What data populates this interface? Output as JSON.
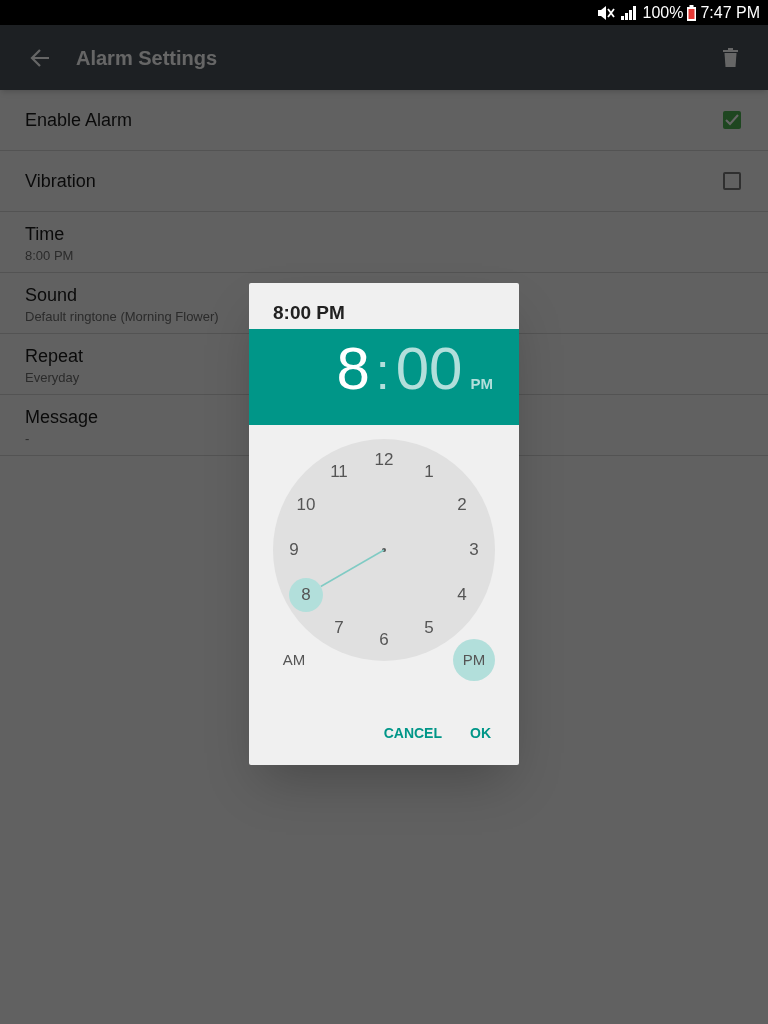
{
  "status_bar": {
    "battery": "100%",
    "time": "7:47 PM"
  },
  "toolbar": {
    "title": "Alarm Settings"
  },
  "settings": [
    {
      "kind": "checkbox",
      "title": "Enable Alarm",
      "checked": true
    },
    {
      "kind": "checkbox",
      "title": "Vibration",
      "checked": false
    },
    {
      "kind": "value",
      "title": "Time",
      "value": "8:00 PM"
    },
    {
      "kind": "value",
      "title": "Sound",
      "value": "Default ringtone (Morning Flower)"
    },
    {
      "kind": "value",
      "title": "Repeat",
      "value": "Everyday"
    },
    {
      "kind": "value",
      "title": "Message",
      "value": "-"
    }
  ],
  "dialog": {
    "title": "8:00 PM",
    "time_header": {
      "hour": {
        "text": "8",
        "selected": true
      },
      "separator": ":",
      "minute": {
        "text": "00",
        "selected": false
      },
      "period": "PM"
    },
    "dial": [
      {
        "label": "12",
        "selected": false
      },
      {
        "label": "1",
        "selected": false
      },
      {
        "label": "2",
        "selected": false
      },
      {
        "label": "3",
        "selected": false
      },
      {
        "label": "4",
        "selected": false
      },
      {
        "label": "5",
        "selected": false
      },
      {
        "label": "6",
        "selected": false
      },
      {
        "label": "7",
        "selected": false
      },
      {
        "label": "8",
        "selected": true
      },
      {
        "label": "9",
        "selected": false
      },
      {
        "label": "10",
        "selected": false
      },
      {
        "label": "11",
        "selected": false
      }
    ],
    "periods": [
      {
        "label": "AM",
        "selected": false
      },
      {
        "label": "PM",
        "selected": true
      }
    ],
    "buttons": [
      "CANCEL",
      "OK"
    ]
  }
}
